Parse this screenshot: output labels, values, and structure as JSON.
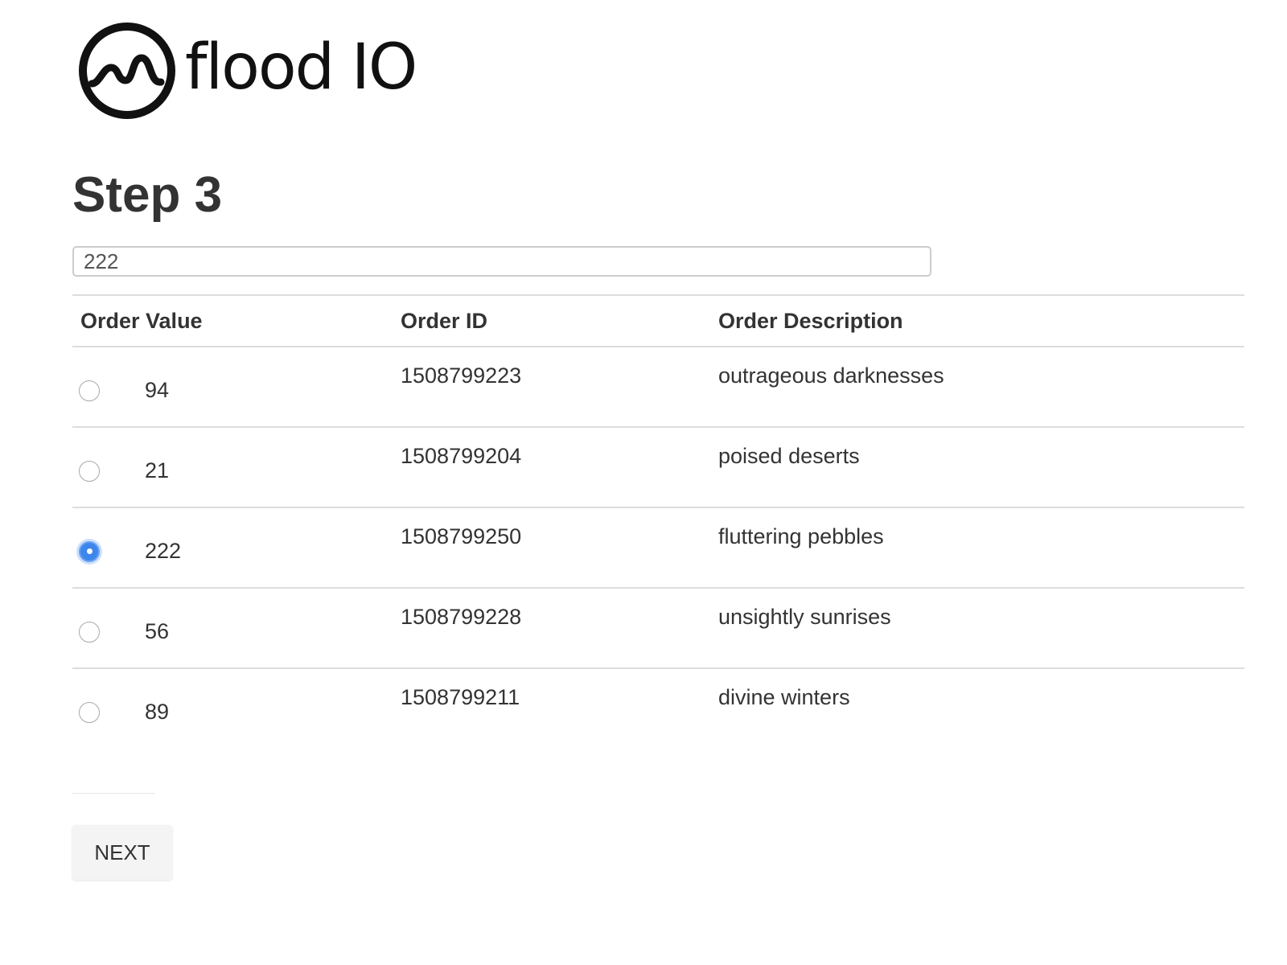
{
  "brand": {
    "logo_text": "flood IO"
  },
  "step": {
    "title": "Step 3"
  },
  "order_input": {
    "value": "222"
  },
  "table": {
    "headers": [
      "Order Value",
      "Order ID",
      "Order Description"
    ],
    "rows": [
      {
        "value": "94",
        "order_id": "1508799223",
        "description": "outrageous darknesses",
        "selected": false
      },
      {
        "value": "21",
        "order_id": "1508799204",
        "description": "poised deserts",
        "selected": false
      },
      {
        "value": "222",
        "order_id": "1508799250",
        "description": "fluttering pebbles",
        "selected": true
      },
      {
        "value": "56",
        "order_id": "1508799228",
        "description": "unsightly sunrises",
        "selected": false
      },
      {
        "value": "89",
        "order_id": "1508799211",
        "description": "divine winters",
        "selected": false
      }
    ]
  },
  "actions": {
    "next_label": "NEXT"
  },
  "colors": {
    "text": "#333333",
    "border": "#dddddd",
    "radio_checked": "#3d86ec"
  }
}
